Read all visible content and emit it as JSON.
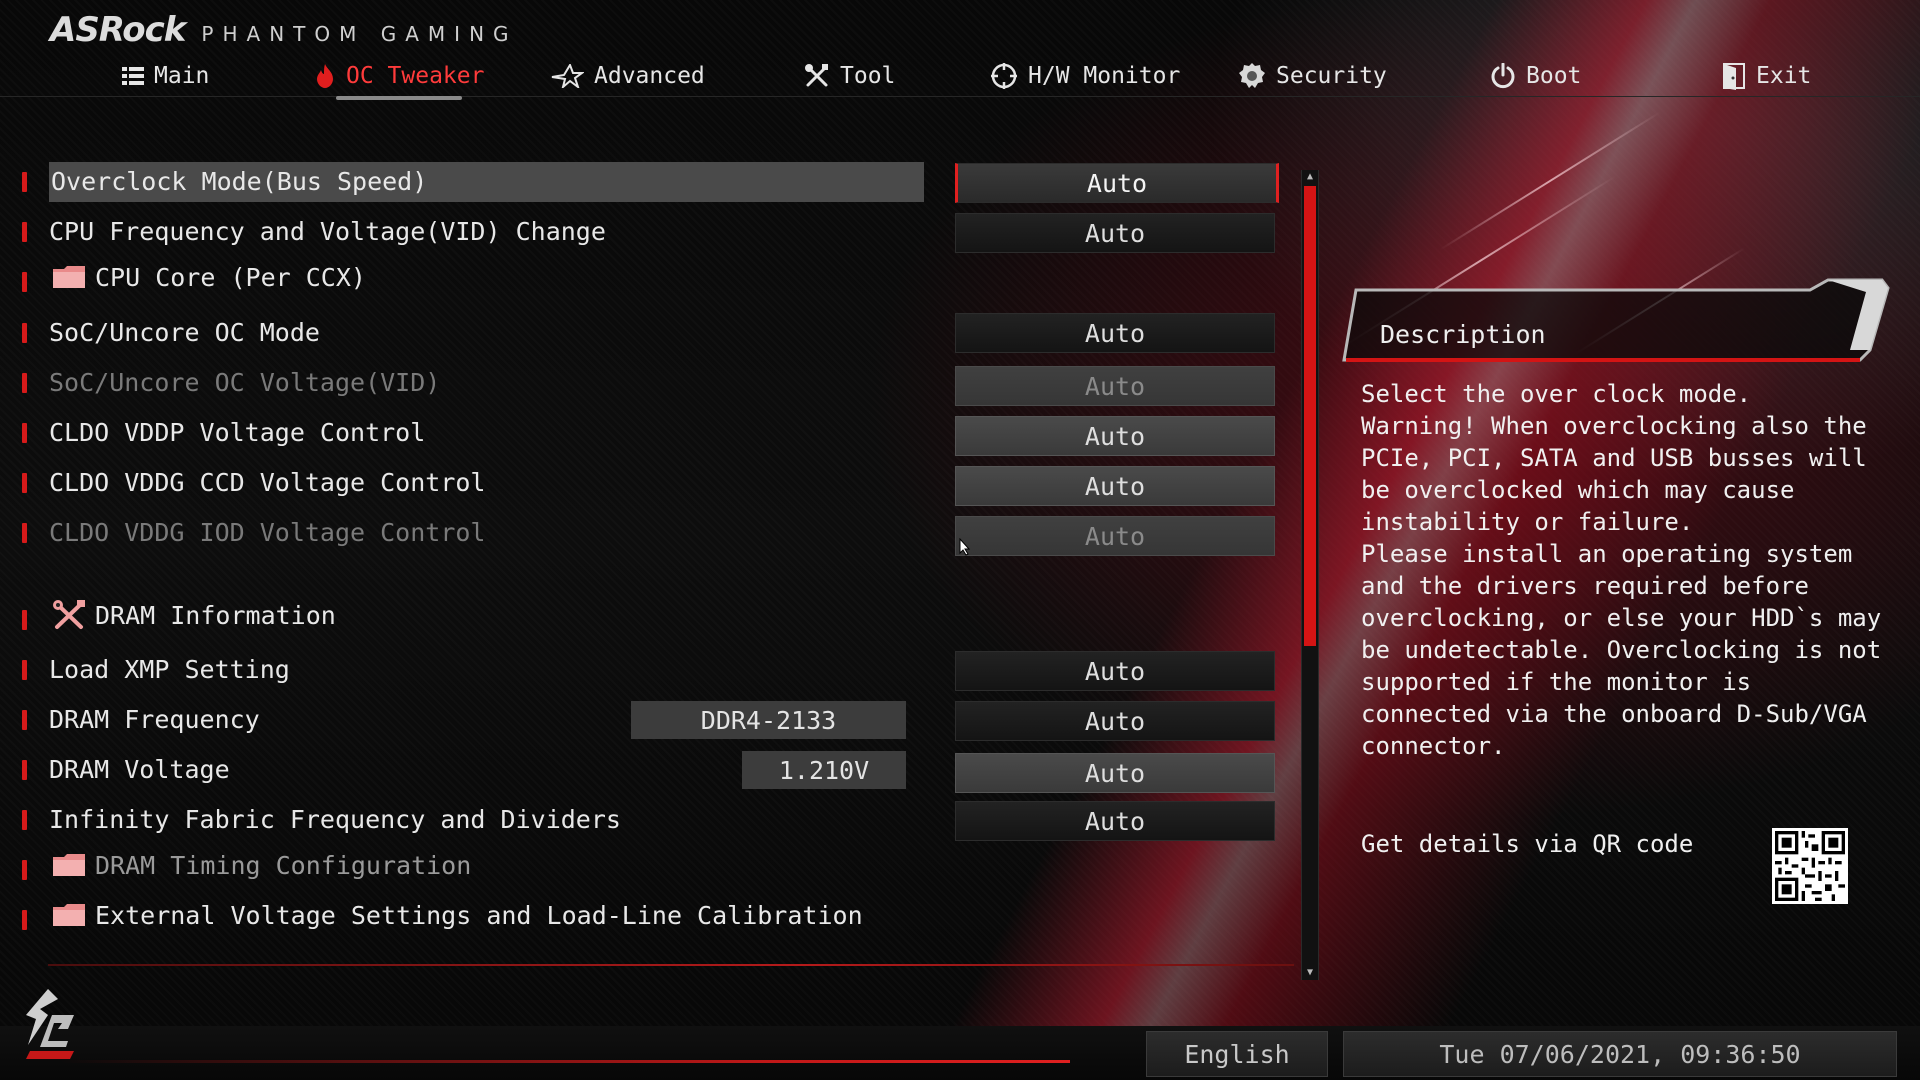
{
  "header": {
    "brand": "ASRock",
    "subbrand": "PHANTOM GAMING"
  },
  "nav": {
    "tabs": [
      {
        "label": "Main"
      },
      {
        "label": "OC Tweaker"
      },
      {
        "label": "Advanced"
      },
      {
        "label": "Tool"
      },
      {
        "label": "H/W Monitor"
      },
      {
        "label": "Security"
      },
      {
        "label": "Boot"
      },
      {
        "label": "Exit"
      }
    ],
    "active_color": "#ff3b3b"
  },
  "settings": {
    "overclock_mode": {
      "label": "Overclock Mode(Bus Speed)",
      "value": "Auto"
    },
    "cpu_freq_voltage": {
      "label": "CPU Frequency and Voltage(VID) Change",
      "value": "Auto"
    },
    "cpu_core": {
      "label": "CPU Core (Per CCX)"
    },
    "soc_uncore_oc_mode": {
      "label": "SoC/Uncore OC Mode",
      "value": "Auto"
    },
    "soc_uncore_oc_voltage": {
      "label": "SoC/Uncore OC Voltage(VID)",
      "value": "Auto"
    },
    "cldo_vddp": {
      "label": "CLDO VDDP Voltage Control",
      "value": "Auto"
    },
    "cldo_vddg_ccd": {
      "label": "CLDO VDDG CCD Voltage Control",
      "value": "Auto"
    },
    "cldo_vddg_iod": {
      "label": "CLDO VDDG IOD Voltage Control",
      "value": "Auto"
    },
    "dram_information": {
      "label": "DRAM Information"
    },
    "load_xmp": {
      "label": "Load XMP Setting",
      "value": "Auto"
    },
    "dram_frequency": {
      "label": "DRAM Frequency",
      "info": "DDR4-2133",
      "value": "Auto"
    },
    "dram_voltage": {
      "label": "DRAM Voltage",
      "info": "1.210V",
      "value": "Auto"
    },
    "infinity_fabric": {
      "label": "Infinity Fabric Frequency and Dividers",
      "value": "Auto"
    },
    "dram_timing": {
      "label": "DRAM Timing Configuration"
    },
    "external_voltage": {
      "label": "External Voltage Settings and Load-Line Calibration"
    }
  },
  "description": {
    "title": "Description",
    "lines": [
      "Select the over clock mode.",
      "Warning! When overclocking also the",
      "PCIe, PCI, SATA and USB busses will",
      "be overclocked which may cause",
      "instability or failure.",
      "Please install an operating system",
      "and the drivers required before",
      "overclocking, or else your HDD`s may",
      "be undetectable. Overclocking is not",
      "supported if the monitor is",
      "connected via the onboard D-Sub/VGA",
      "connector."
    ],
    "qr_label": "Get details via QR code"
  },
  "footer": {
    "language": "English",
    "datetime": "Tue 07/06/2021, 09:36:50"
  },
  "colors": {
    "accent_red": "#d61a1a",
    "selected_row": "#4a4a4a"
  }
}
